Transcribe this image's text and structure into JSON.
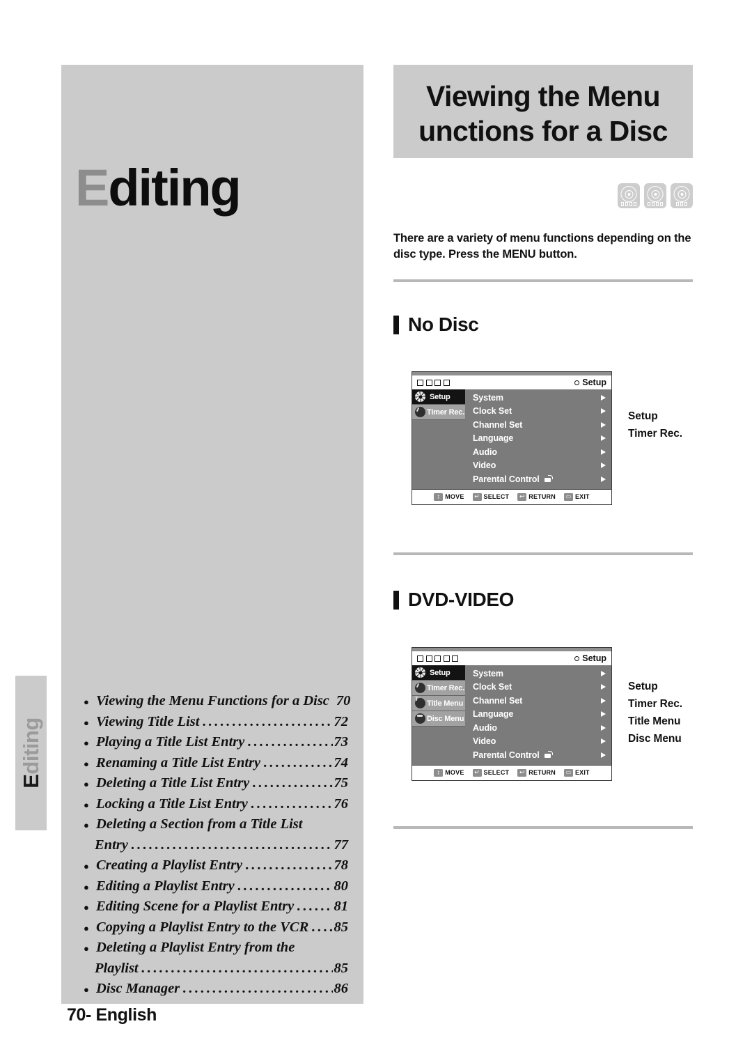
{
  "page": {
    "side_tab_label": "Editing",
    "side_tab_cap": "E",
    "chapter_title_cap": "E",
    "chapter_title_rest": "diting",
    "footer_page": "70",
    "footer_dash": "-",
    "footer_language": "English"
  },
  "banner": {
    "line1": "Viewing the Menu",
    "line2": "unctions for a Disc"
  },
  "disc_badges": [
    {
      "name": "dvd-ram-badge",
      "blocks": 4
    },
    {
      "name": "dvd-rw-badge",
      "blocks": 4
    },
    {
      "name": "dvd-r-badge",
      "blocks": 3
    }
  ],
  "intro": {
    "text": "There are a variety of menu functions depending on the disc type. Press the MENU button."
  },
  "sections": [
    {
      "heading": "No Disc",
      "osd": {
        "squares": 4,
        "title_right": "Setup",
        "tabs": [
          {
            "label": "Setup",
            "icon": "gear-icon",
            "active": true
          },
          {
            "label": "Timer Rec.",
            "icon": "clock-pie-icon",
            "active": false
          }
        ],
        "items": [
          {
            "label": "System",
            "arrow": true,
            "lock": false
          },
          {
            "label": "Clock Set",
            "arrow": true,
            "lock": false
          },
          {
            "label": "Channel Set",
            "arrow": true,
            "lock": false
          },
          {
            "label": "Language",
            "arrow": true,
            "lock": false
          },
          {
            "label": "Audio",
            "arrow": true,
            "lock": false
          },
          {
            "label": "Video",
            "arrow": true,
            "lock": false
          },
          {
            "label": "Parental Control",
            "arrow": true,
            "lock": true
          }
        ],
        "footbar": [
          {
            "key": "move",
            "label": "MOVE"
          },
          {
            "key": "select",
            "label": "SELECT"
          },
          {
            "key": "return",
            "label": "RETURN"
          },
          {
            "key": "exit",
            "label": "EXIT"
          }
        ]
      },
      "captions": [
        "Setup",
        "Timer Rec."
      ]
    },
    {
      "heading": "DVD-VIDEO",
      "osd": {
        "squares": 5,
        "title_right": "Setup",
        "tabs": [
          {
            "label": "Setup",
            "icon": "gear-icon",
            "active": true
          },
          {
            "label": "Timer Rec.",
            "icon": "clock-pie-icon",
            "active": false
          },
          {
            "label": "Title Menu",
            "icon": "title-pie-icon",
            "active": false
          },
          {
            "label": "Disc Menu",
            "icon": "disc-pie-icon",
            "active": false
          }
        ],
        "items": [
          {
            "label": "System",
            "arrow": true,
            "lock": false
          },
          {
            "label": "Clock Set",
            "arrow": true,
            "lock": false
          },
          {
            "label": "Channel Set",
            "arrow": true,
            "lock": false
          },
          {
            "label": "Language",
            "arrow": true,
            "lock": false
          },
          {
            "label": "Audio",
            "arrow": true,
            "lock": false
          },
          {
            "label": "Video",
            "arrow": true,
            "lock": false
          },
          {
            "label": "Parental Control",
            "arrow": true,
            "lock": true
          }
        ],
        "footbar": [
          {
            "key": "move",
            "label": "MOVE"
          },
          {
            "key": "select",
            "label": "SELECT"
          },
          {
            "key": "return",
            "label": "RETURN"
          },
          {
            "key": "exit",
            "label": "EXIT"
          }
        ]
      },
      "captions": [
        "Setup",
        "Timer Rec.",
        "Title Menu",
        "Disc Menu"
      ]
    }
  ],
  "toc": [
    {
      "label": "Viewing the Menu Functions for a Disc",
      "page": "70",
      "leader": false
    },
    {
      "label": "Viewing Title List",
      "page": "72",
      "leader": true
    },
    {
      "label": "Playing a Title List Entry",
      "page": "73",
      "leader": true
    },
    {
      "label": "Renaming a Title List Entry",
      "page": "74",
      "leader": true
    },
    {
      "label": "Deleting a Title List Entry",
      "page": "75",
      "leader": true
    },
    {
      "label": "Locking a Title List Entry",
      "page": "76",
      "leader": true
    },
    {
      "label": "Deleting a Section from a Title List",
      "page": "",
      "leader": false
    },
    {
      "label": "Entry",
      "page": "77",
      "leader": true,
      "cont": true
    },
    {
      "label": "Creating a Playlist Entry",
      "page": "78",
      "leader": true
    },
    {
      "label": "Editing a Playlist Entry",
      "page": "80",
      "leader": true
    },
    {
      "label": "Editing Scene for a Playlist Entry",
      "page": "81",
      "leader": true
    },
    {
      "label": "Copying a Playlist Entry to the VCR",
      "page": "85",
      "leader": true
    },
    {
      "label": "Deleting a Playlist Entry from the",
      "page": "",
      "leader": false
    },
    {
      "label": "Playlist",
      "page": "85",
      "leader": true,
      "cont": true
    },
    {
      "label": "Disc Manager",
      "page": "86",
      "leader": true
    }
  ]
}
